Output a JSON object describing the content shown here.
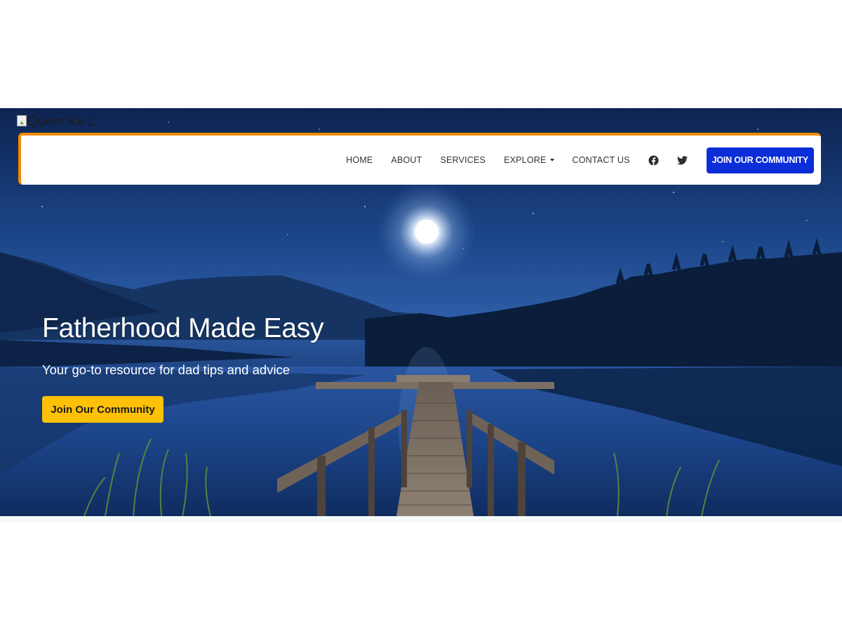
{
  "logo": {
    "alt_text": "Queer Ke L"
  },
  "nav": {
    "links": [
      {
        "label": "HOME"
      },
      {
        "label": "ABOUT"
      },
      {
        "label": "SERVICES"
      },
      {
        "label": "EXPLORE"
      },
      {
        "label": "CONTACT US"
      }
    ],
    "social": [
      {
        "icon": "facebook-icon"
      },
      {
        "icon": "twitter-icon"
      }
    ],
    "cta_label": "JOIN OUR COMMUNITY"
  },
  "hero": {
    "title": "Fatherhood Made Easy",
    "subtitle": "Your go-to resource for dad tips and advice",
    "cta_label": "Join Our Community"
  },
  "colors": {
    "nav_accent": "#f08a00",
    "nav_cta_bg": "#0b2ed9",
    "hero_cta_bg": "#ffc107"
  }
}
